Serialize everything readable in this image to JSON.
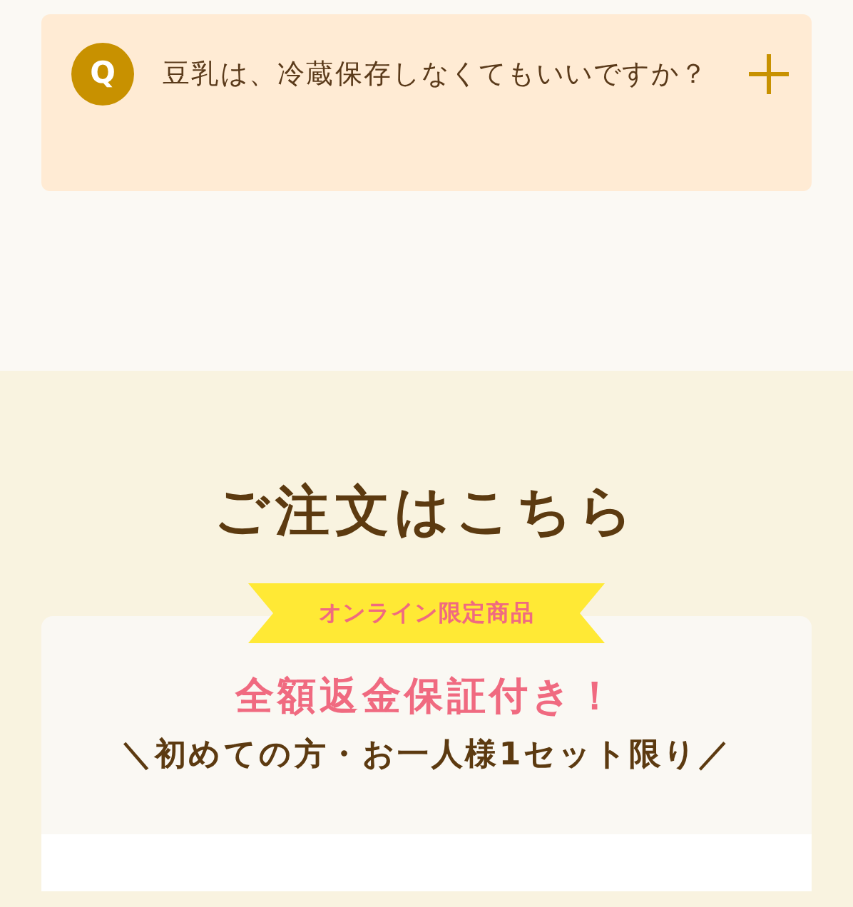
{
  "faq": [
    {
      "marker": "Q",
      "question": "豆乳は、冷蔵保存しなくてもいいですか？",
      "expanded": false
    }
  ],
  "order": {
    "heading": "ご注文はこちら",
    "ribbon": "オンライン限定商品",
    "guarantee": "全額返金保証付き！",
    "limit": "＼初めての方・お一人様1セット限り／"
  }
}
